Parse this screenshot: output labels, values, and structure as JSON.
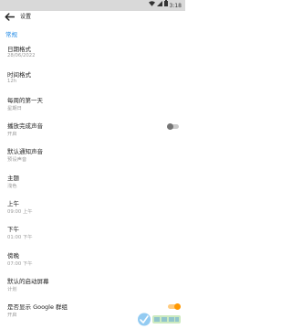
{
  "status_bar": {
    "time": "3:18"
  },
  "toolbar": {
    "title": "设置"
  },
  "section": {
    "header": "常规"
  },
  "settings": [
    {
      "title": "日期格式",
      "subtitle": "28/06/2022"
    },
    {
      "title": "时间格式",
      "subtitle": "12h"
    },
    {
      "title": "每周的第一天",
      "subtitle": "星期日"
    },
    {
      "title": "播放完成声音",
      "subtitle": "开启"
    },
    {
      "title": "默认通知声音",
      "subtitle": "预设声音"
    },
    {
      "title": "主题",
      "subtitle": "浅色"
    },
    {
      "title": "上午",
      "subtitle": "09:00 上午"
    },
    {
      "title": "下午",
      "subtitle": "01:00 下午"
    },
    {
      "title": "傍晚",
      "subtitle": "07:00 下午"
    },
    {
      "title": "默认的启动屏幕",
      "subtitle": "计划"
    },
    {
      "title": "是否显示 Google 群组",
      "subtitle": "开启"
    }
  ],
  "toggles": {
    "play_sound": false,
    "show_google_groups": true
  },
  "colors": {
    "accent": "#1e88e5",
    "toggle_on": "#ff9800",
    "toggle_off": "#9e9e9e"
  }
}
